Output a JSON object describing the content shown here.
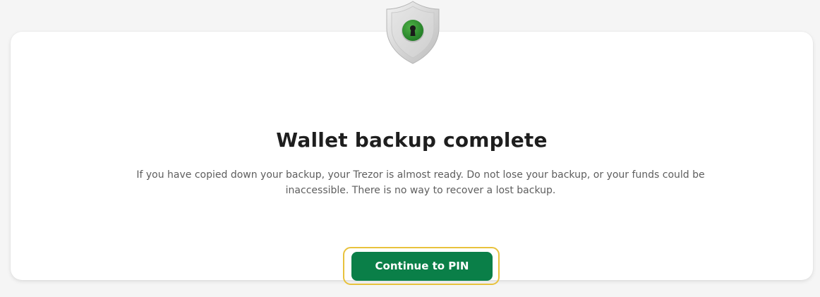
{
  "hero": {
    "icon": "shield-keyhole-icon",
    "title": "Wallet backup complete",
    "description": "If you have copied down your backup, your Trezor is almost ready. Do not lose your backup, or your funds could be inaccessible. There is no way to recover a lost backup."
  },
  "actions": {
    "continue_label": "Continue to PIN"
  },
  "colors": {
    "accent": "#0a7f48",
    "focus_ring": "#e8c23d",
    "background": "#f5f5f5",
    "card": "#ffffff"
  }
}
